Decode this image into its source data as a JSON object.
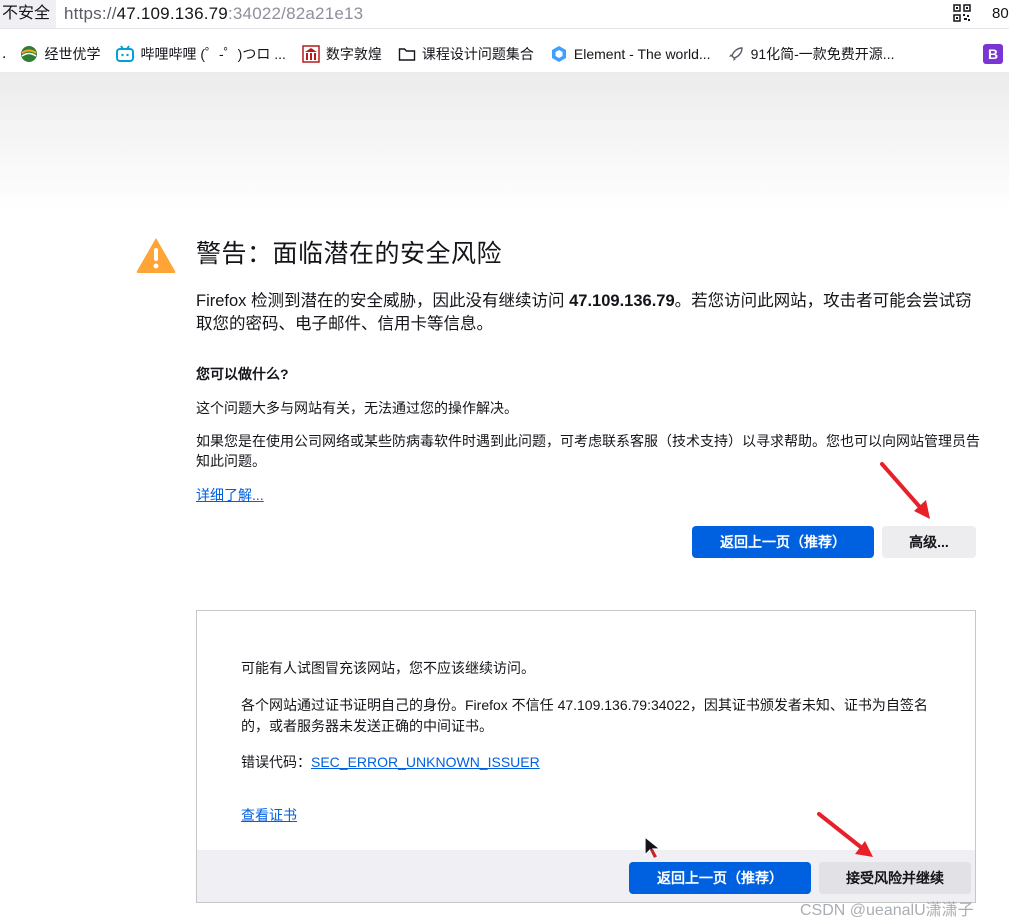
{
  "urlbar": {
    "security_label": "不安全",
    "url_scheme": "https://",
    "url_host": "47.109.136.79",
    "url_path": ":34022/82a21e13",
    "tail_text": "80"
  },
  "bookmarks": {
    "leading": ".",
    "items": [
      {
        "label": "经世优学",
        "icon": "globe-icon"
      },
      {
        "label": "哔哩哔哩 (゜-゜)つロ ...",
        "icon": "bilibili-icon"
      },
      {
        "label": "数字敦煌",
        "icon": "temple-icon"
      },
      {
        "label": "课程设计问题集合",
        "icon": "folder-icon"
      },
      {
        "label": "Element - The world...",
        "icon": "element-icon"
      },
      {
        "label": "91化简-一款免费开源...",
        "icon": "rocket-icon"
      }
    ],
    "trailing_badge": "B"
  },
  "warning": {
    "title": "警告：面临潜在的安全风险",
    "intro_prefix": "Firefox 检测到潜在的安全威胁，因此没有继续访问 ",
    "intro_host": "47.109.136.79",
    "intro_suffix": "。若您访问此网站，攻击者可能会尝试窃取您的密码、电子邮件、信用卡等信息。",
    "what_can_do": "您可以做什么?",
    "para1": "这个问题大多与网站有关，无法通过您的操作解决。",
    "para2": "如果您是在使用公司网络或某些防病毒软件时遇到此问题，可考虑联系客服（技术支持）以寻求帮助。您也可以向网站管理员告知此问题。",
    "learn_more": "详细了解...",
    "back_button": "返回上一页（推荐）",
    "advanced_button": "高级..."
  },
  "advanced": {
    "line1": "可能有人试图冒充该网站，您不应该继续访问。",
    "line2": "各个网站通过证书证明自己的身份。Firefox 不信任 47.109.136.79:34022，因其证书颁发者未知、证书为自签名的，或者服务器未发送正确的中间证书。",
    "error_label": "错误代码：",
    "error_code": "SEC_ERROR_UNKNOWN_ISSUER",
    "view_cert": "查看证书",
    "back_button": "返回上一页（推荐）",
    "accept_button": "接受风险并继续"
  },
  "watermark": "CSDN @ueanalU潇潇子",
  "colors": {
    "primary": "#0061e0",
    "link": "#0060df",
    "warning": "#ffa436",
    "annotation": "#e8202a"
  }
}
